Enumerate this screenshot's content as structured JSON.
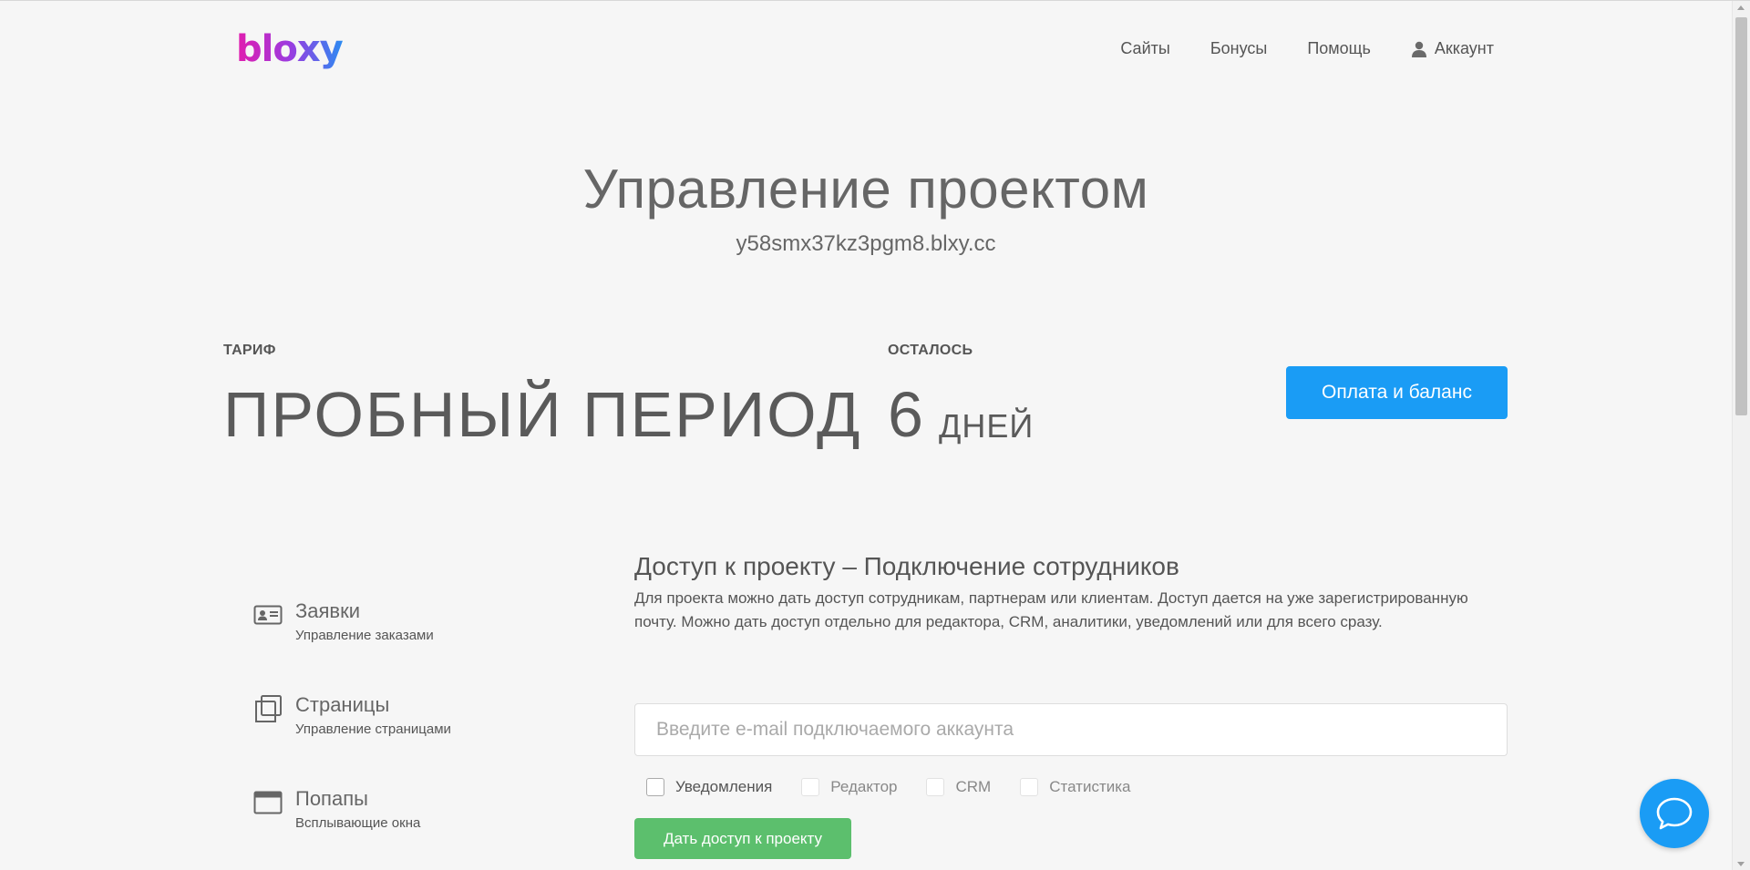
{
  "header": {
    "logo_text": "bloxy",
    "nav": [
      {
        "label": "Сайты"
      },
      {
        "label": "Бонусы"
      },
      {
        "label": "Помощь"
      },
      {
        "label": "Аккаунт",
        "icon": "user-icon"
      }
    ]
  },
  "project": {
    "title": "Управление проектом",
    "domain": "y58smx37kz3pgm8.blxy.cc"
  },
  "tariff": {
    "label": "ТАРИФ",
    "value": "ПРОБНЫЙ ПЕРИОД",
    "remaining_label": "ОСТАЛОСЬ",
    "remaining_number": "6",
    "remaining_unit": "ДНЕЙ",
    "pay_button": "Оплата и баланс"
  },
  "sidebar": {
    "items": [
      {
        "title": "Заявки",
        "subtitle": "Управление заказами",
        "icon": "id-card-icon"
      },
      {
        "title": "Страницы",
        "subtitle": "Управление страницами",
        "icon": "pages-icon"
      },
      {
        "title": "Попапы",
        "subtitle": "Всплывающие окна",
        "icon": "window-icon"
      }
    ]
  },
  "access": {
    "heading": "Доступ к проекту – Подключение сотрудников",
    "description": "Для проекта можно дать доступ сотрудникам, партнерам или клиентам. Доступ дается на уже зарегистрированную почту. Можно дать доступ отдельно для редактора, CRM, аналитики, уведомлений или для всего сразу.",
    "email_placeholder": "Введите e-mail подключаемого аккаунта",
    "email_value": "",
    "checkboxes": [
      {
        "label": "Уведомления",
        "checked": false
      },
      {
        "label": "Редактор",
        "checked": false
      },
      {
        "label": "CRM",
        "checked": false
      },
      {
        "label": "Статистика",
        "checked": false
      }
    ],
    "grant_button": "Дать доступ к проекту"
  },
  "colors": {
    "primary_blue": "#1a9cf5",
    "success_green": "#5cbf6d",
    "background": "#f6f6f6",
    "logo_gradient": [
      "#e21dae",
      "#9b3be0",
      "#2a8cf2"
    ]
  },
  "chat": {
    "icon": "chat-bubble-icon"
  }
}
